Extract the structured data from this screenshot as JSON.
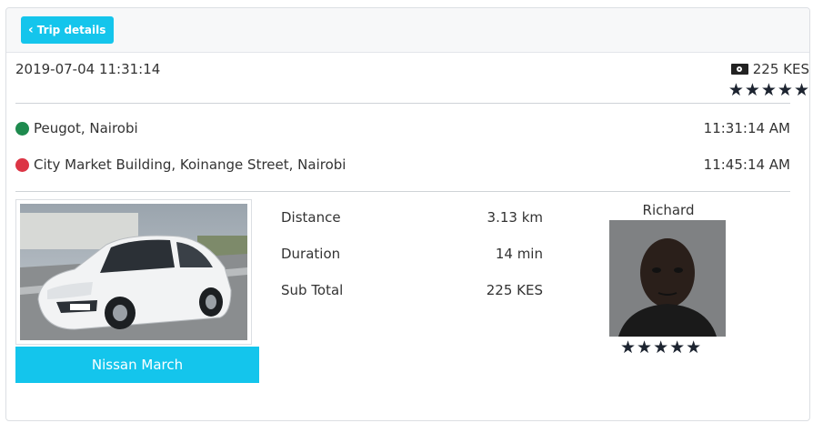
{
  "header": {
    "back_label": "Trip details"
  },
  "trip": {
    "datetime": "2019-07-04 11:31:14",
    "fare": "225 KES",
    "rating_stars": "★★★★★",
    "rating_value": 5
  },
  "route": {
    "pickup": {
      "address": "Peugot, Nairobi",
      "time": "11:31:14 AM",
      "color": "#1e8a4e"
    },
    "dropoff": {
      "address": "City Market Building, Koinange Street, Nairobi",
      "time": "11:45:14 AM",
      "color": "#dc3545"
    }
  },
  "vehicle": {
    "name": "Nissan March"
  },
  "stats": [
    {
      "label": "Distance",
      "value": "3.13 km"
    },
    {
      "label": "Duration",
      "value": "14 min"
    },
    {
      "label": "Sub Total",
      "value": "225 KES"
    }
  ],
  "driver": {
    "name": "Richard",
    "rating_stars": "★★★★★",
    "rating_value": 5
  },
  "colors": {
    "accent": "#14c5ec",
    "star": "#1d2430"
  }
}
